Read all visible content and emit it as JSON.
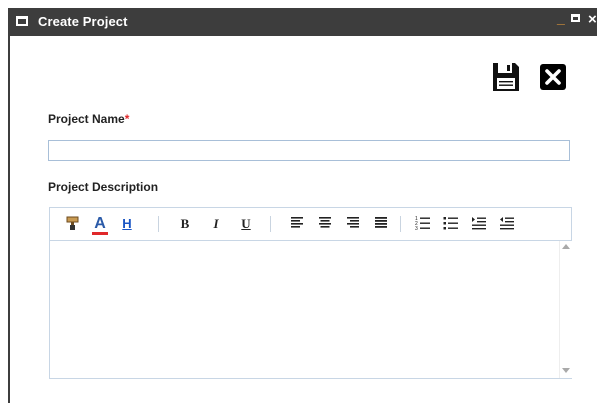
{
  "window": {
    "title": "Create Project",
    "controls": {
      "minimize": "_",
      "close": "×"
    }
  },
  "actions": {
    "save_icon": "floppy-disk-icon",
    "close_icon": "x-square-icon"
  },
  "form": {
    "project_name": {
      "label": "Project Name",
      "required_mark": "*",
      "value": ""
    },
    "project_description": {
      "label": "Project Description",
      "value": ""
    }
  },
  "toolbar": {
    "bold": "B",
    "italic": "I",
    "underline": "U",
    "font_color": "A",
    "highlight": "H"
  },
  "colors": {
    "titlebar": "#3d3d3d",
    "required": "#e0282a",
    "minimize": "#f0a13a",
    "input_border": "#a8bfd8",
    "font_color_underline": "#e0282a",
    "highlight_link": "#1a55c4"
  }
}
